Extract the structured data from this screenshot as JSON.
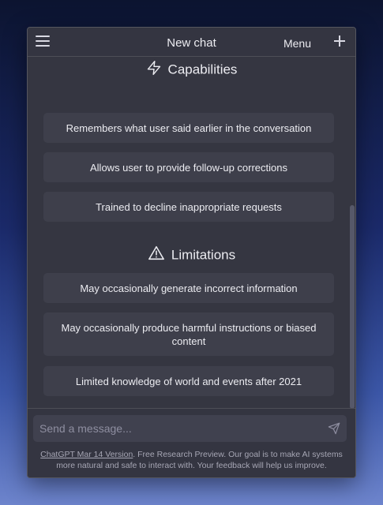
{
  "header": {
    "title": "New chat",
    "menu_label": "Menu"
  },
  "capabilities": {
    "heading": "Capabilities",
    "items": [
      "Remembers what user said earlier in the conversation",
      "Allows user to provide follow-up corrections",
      "Trained to decline inappropriate requests"
    ]
  },
  "limitations": {
    "heading": "Limitations",
    "items": [
      "May occasionally generate incorrect information",
      "May occasionally produce harmful instructions or biased content",
      "Limited knowledge of world and events after 2021"
    ]
  },
  "composer": {
    "placeholder": "Send a message..."
  },
  "footer": {
    "version_link": "ChatGPT Mar 14 Version",
    "disclaimer": ". Free Research Preview. Our goal is to make AI systems more natural and safe to interact with. Your feedback will help us improve."
  },
  "colors": {
    "panel": "#353641",
    "card": "#3e3f4b",
    "text": "#ececf1"
  }
}
